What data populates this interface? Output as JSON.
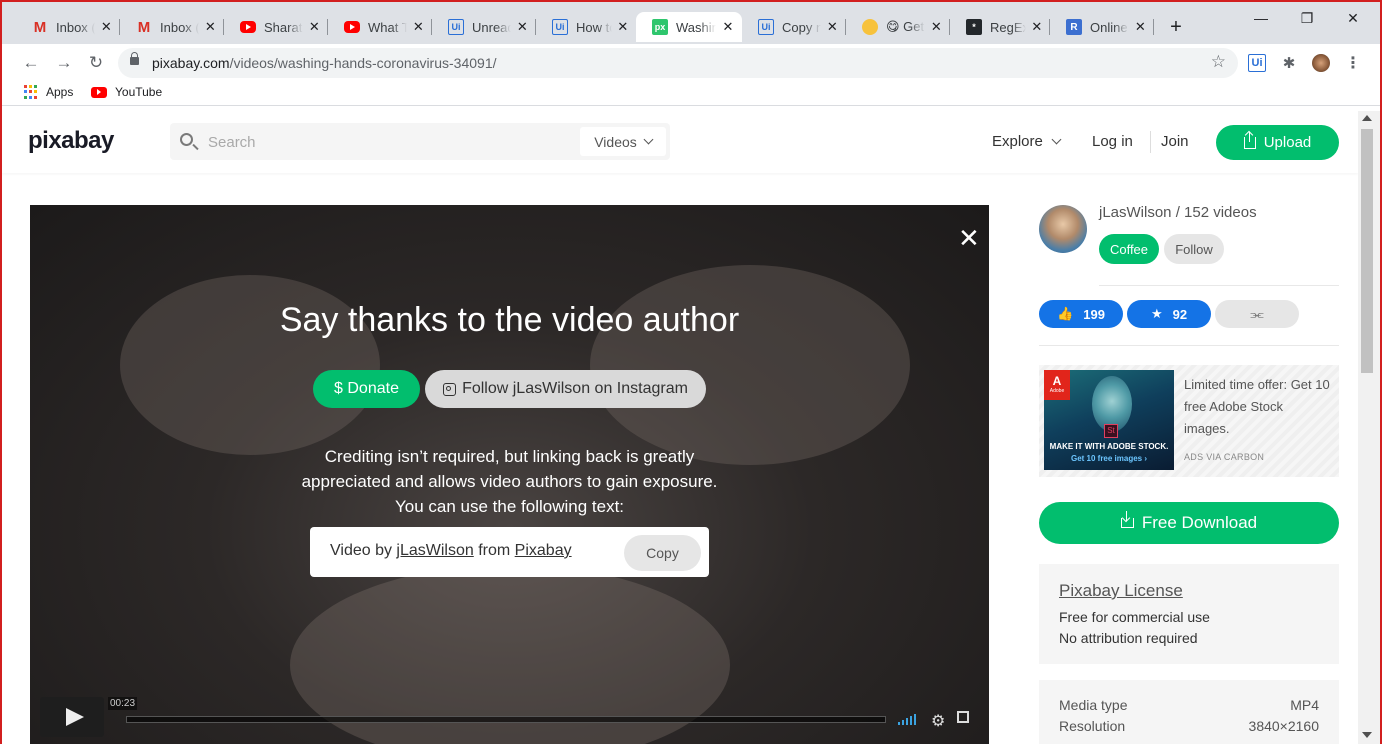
{
  "browser": {
    "tabs": [
      {
        "title": "Inbox (",
        "icon": "gmail-icon"
      },
      {
        "title": "Inbox (",
        "icon": "gmail-icon"
      },
      {
        "title": "Sharath",
        "icon": "youtube-icon"
      },
      {
        "title": "What T",
        "icon": "youtube-icon"
      },
      {
        "title": "Unread",
        "icon": "uipath-icon"
      },
      {
        "title": "How to",
        "icon": "uipath-icon"
      },
      {
        "title": "Washin",
        "icon": "pixabay-icon",
        "active": true
      },
      {
        "title": "Copy n",
        "icon": "uipath-icon"
      },
      {
        "title": "😋 Get",
        "icon": "emoji-icon"
      },
      {
        "title": "RegExr",
        "icon": "regexr-icon"
      },
      {
        "title": "Online",
        "icon": "r-icon"
      }
    ],
    "tab_glyphs": {
      "gmail": "M",
      "ui": "Ui",
      "px": "px",
      "r": "R",
      "close": "✕",
      "new": "+"
    },
    "window_controls": {
      "minimize": "—",
      "maximize": "❐",
      "close": "✕"
    },
    "nav_glyphs": {
      "back": "←",
      "forward": "→",
      "reload": "↻",
      "star": "☆",
      "puzzle": "✱",
      "menu": "⋮"
    },
    "url_host": "pixabay.com",
    "url_path": "/videos/washing-hands-coronavirus-34091/",
    "ext_label": "Ui",
    "bookmarks": {
      "apps": "Apps",
      "youtube": "YouTube"
    }
  },
  "site": {
    "logo": "pixabay",
    "search_placeholder": "Search",
    "search_type": "Videos",
    "nav": {
      "explore": "Explore",
      "login": "Log in",
      "join": "Join",
      "upload": "Upload"
    }
  },
  "video": {
    "close": "✕",
    "heading": "Say thanks to the video author",
    "donate": "$ Donate",
    "instagram": "Follow jLasWilson on Instagram",
    "credit_lines": [
      "Crediting isn’t required, but linking back is greatly",
      "appreciated and allows video authors to gain exposure.",
      "You can use the following text:"
    ],
    "attribution": {
      "prefix": "Video by ",
      "author": "jLasWilson",
      "middle": " from ",
      "site": "Pixabay"
    },
    "copy": "Copy",
    "time": "00:23",
    "gear": "⚙"
  },
  "sidebar": {
    "author_line": "jLasWilson / 152 videos",
    "coffee": "Coffee",
    "follow": "Follow",
    "likes": "199",
    "favorites": "92",
    "like_glyph": "👍",
    "fav_glyph": "★",
    "share_glyph": "⫘",
    "ad": {
      "logo": "A",
      "brand": "Adobe",
      "st": "St",
      "img_line1": "MAKE IT WITH ADOBE STOCK.",
      "img_line2": "Get 10 free images ›",
      "text": "Limited time offer: Get 10 free Adobe Stock images.",
      "via": "ADS VIA CARBON"
    },
    "free_download": "Free Download",
    "license": {
      "title": "Pixabay License",
      "line1": "Free for commercial use",
      "line2": "No attribution required"
    },
    "media": [
      {
        "label": "Media type",
        "value": "MP4"
      },
      {
        "label": "Resolution",
        "value": "3840×2160"
      }
    ]
  },
  "colors": {
    "accent": "#02be6e",
    "like": "#1473e6",
    "frame": "#d21f1f"
  }
}
